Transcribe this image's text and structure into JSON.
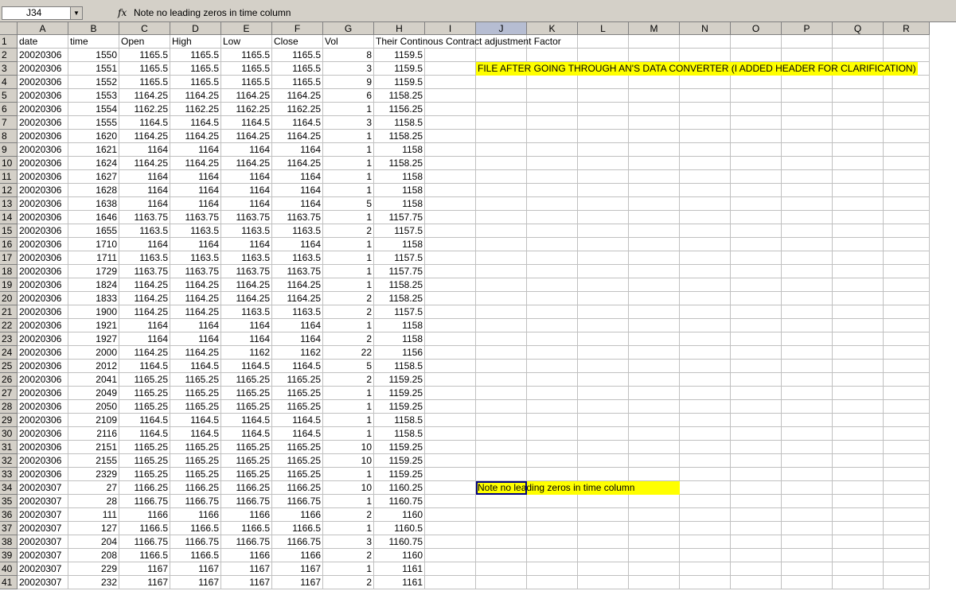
{
  "formula_bar": {
    "name_box": "J34",
    "fx": "fx",
    "content": "Note  no leading zeros in time column"
  },
  "columns": [
    "A",
    "B",
    "C",
    "D",
    "E",
    "F",
    "G",
    "H",
    "I",
    "J",
    "K",
    "L",
    "M",
    "N",
    "O",
    "P",
    "Q",
    "R"
  ],
  "selected_column": "J",
  "selected_row": 34,
  "header_row": [
    "date",
    "time",
    "Open",
    "High",
    "Low",
    "Close",
    "Vol",
    "Their Continous Contract adjustment Factor"
  ],
  "rows": [
    [
      "20020306",
      "1550",
      "1165.5",
      "1165.5",
      "1165.5",
      "1165.5",
      "8",
      "1159.5"
    ],
    [
      "20020306",
      "1551",
      "1165.5",
      "1165.5",
      "1165.5",
      "1165.5",
      "3",
      "1159.5"
    ],
    [
      "20020306",
      "1552",
      "1165.5",
      "1165.5",
      "1165.5",
      "1165.5",
      "9",
      "1159.5"
    ],
    [
      "20020306",
      "1553",
      "1164.25",
      "1164.25",
      "1164.25",
      "1164.25",
      "6",
      "1158.25"
    ],
    [
      "20020306",
      "1554",
      "1162.25",
      "1162.25",
      "1162.25",
      "1162.25",
      "1",
      "1156.25"
    ],
    [
      "20020306",
      "1555",
      "1164.5",
      "1164.5",
      "1164.5",
      "1164.5",
      "3",
      "1158.5"
    ],
    [
      "20020306",
      "1620",
      "1164.25",
      "1164.25",
      "1164.25",
      "1164.25",
      "1",
      "1158.25"
    ],
    [
      "20020306",
      "1621",
      "1164",
      "1164",
      "1164",
      "1164",
      "1",
      "1158"
    ],
    [
      "20020306",
      "1624",
      "1164.25",
      "1164.25",
      "1164.25",
      "1164.25",
      "1",
      "1158.25"
    ],
    [
      "20020306",
      "1627",
      "1164",
      "1164",
      "1164",
      "1164",
      "1",
      "1158"
    ],
    [
      "20020306",
      "1628",
      "1164",
      "1164",
      "1164",
      "1164",
      "1",
      "1158"
    ],
    [
      "20020306",
      "1638",
      "1164",
      "1164",
      "1164",
      "1164",
      "5",
      "1158"
    ],
    [
      "20020306",
      "1646",
      "1163.75",
      "1163.75",
      "1163.75",
      "1163.75",
      "1",
      "1157.75"
    ],
    [
      "20020306",
      "1655",
      "1163.5",
      "1163.5",
      "1163.5",
      "1163.5",
      "2",
      "1157.5"
    ],
    [
      "20020306",
      "1710",
      "1164",
      "1164",
      "1164",
      "1164",
      "1",
      "1158"
    ],
    [
      "20020306",
      "1711",
      "1163.5",
      "1163.5",
      "1163.5",
      "1163.5",
      "1",
      "1157.5"
    ],
    [
      "20020306",
      "1729",
      "1163.75",
      "1163.75",
      "1163.75",
      "1163.75",
      "1",
      "1157.75"
    ],
    [
      "20020306",
      "1824",
      "1164.25",
      "1164.25",
      "1164.25",
      "1164.25",
      "1",
      "1158.25"
    ],
    [
      "20020306",
      "1833",
      "1164.25",
      "1164.25",
      "1164.25",
      "1164.25",
      "2",
      "1158.25"
    ],
    [
      "20020306",
      "1900",
      "1164.25",
      "1164.25",
      "1163.5",
      "1163.5",
      "2",
      "1157.5"
    ],
    [
      "20020306",
      "1921",
      "1164",
      "1164",
      "1164",
      "1164",
      "1",
      "1158"
    ],
    [
      "20020306",
      "1927",
      "1164",
      "1164",
      "1164",
      "1164",
      "2",
      "1158"
    ],
    [
      "20020306",
      "2000",
      "1164.25",
      "1164.25",
      "1162",
      "1162",
      "22",
      "1156"
    ],
    [
      "20020306",
      "2012",
      "1164.5",
      "1164.5",
      "1164.5",
      "1164.5",
      "5",
      "1158.5"
    ],
    [
      "20020306",
      "2041",
      "1165.25",
      "1165.25",
      "1165.25",
      "1165.25",
      "2",
      "1159.25"
    ],
    [
      "20020306",
      "2049",
      "1165.25",
      "1165.25",
      "1165.25",
      "1165.25",
      "1",
      "1159.25"
    ],
    [
      "20020306",
      "2050",
      "1165.25",
      "1165.25",
      "1165.25",
      "1165.25",
      "1",
      "1159.25"
    ],
    [
      "20020306",
      "2109",
      "1164.5",
      "1164.5",
      "1164.5",
      "1164.5",
      "1",
      "1158.5"
    ],
    [
      "20020306",
      "2116",
      "1164.5",
      "1164.5",
      "1164.5",
      "1164.5",
      "1",
      "1158.5"
    ],
    [
      "20020306",
      "2151",
      "1165.25",
      "1165.25",
      "1165.25",
      "1165.25",
      "10",
      "1159.25"
    ],
    [
      "20020306",
      "2155",
      "1165.25",
      "1165.25",
      "1165.25",
      "1165.25",
      "10",
      "1159.25"
    ],
    [
      "20020306",
      "2329",
      "1165.25",
      "1165.25",
      "1165.25",
      "1165.25",
      "1",
      "1159.25"
    ],
    [
      "20020307",
      "27",
      "1166.25",
      "1166.25",
      "1166.25",
      "1166.25",
      "10",
      "1160.25"
    ],
    [
      "20020307",
      "28",
      "1166.75",
      "1166.75",
      "1166.75",
      "1166.75",
      "1",
      "1160.75"
    ],
    [
      "20020307",
      "111",
      "1166",
      "1166",
      "1166",
      "1166",
      "2",
      "1160"
    ],
    [
      "20020307",
      "127",
      "1166.5",
      "1166.5",
      "1166.5",
      "1166.5",
      "1",
      "1160.5"
    ],
    [
      "20020307",
      "204",
      "1166.75",
      "1166.75",
      "1166.75",
      "1166.75",
      "3",
      "1160.75"
    ],
    [
      "20020307",
      "208",
      "1166.5",
      "1166.5",
      "1166",
      "1166",
      "2",
      "1160"
    ],
    [
      "20020307",
      "229",
      "1167",
      "1167",
      "1167",
      "1167",
      "1",
      "1161"
    ],
    [
      "20020307",
      "232",
      "1167",
      "1167",
      "1167",
      "1167",
      "2",
      "1161"
    ]
  ],
  "notes": {
    "header_note": "FILE AFTER GOING THROUGH AN'S DATA CONVERTER (I ADDED HEADER FOR CLARIFICATION)",
    "cell_note": "Note  no leading zeros in time column"
  },
  "colors": {
    "highlight": "#ffff00",
    "selection_border": "#000080"
  }
}
